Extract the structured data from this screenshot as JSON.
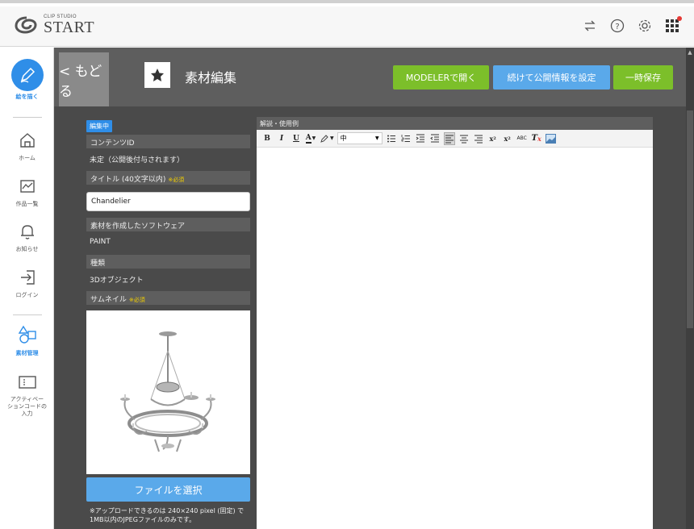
{
  "app": {
    "logo_small": "CLIP STUDIO",
    "logo_big": "START"
  },
  "sidebar": {
    "items": [
      {
        "label": "絵を描く",
        "icon": "pen-icon"
      },
      {
        "label": "ホーム",
        "icon": "home-icon"
      },
      {
        "label": "作品一覧",
        "icon": "gallery-icon"
      },
      {
        "label": "お知らせ",
        "icon": "bell-icon"
      },
      {
        "label": "ログイン",
        "icon": "login-icon"
      },
      {
        "label": "素材管理",
        "icon": "materials-icon"
      },
      {
        "label": "アクティベーションコードの入力",
        "label_lines": [
          "アクティベー",
          "ションコードの",
          "入力"
        ],
        "icon": "ticket-icon"
      }
    ]
  },
  "header": {
    "back_label": "< もどる",
    "title": "素材編集",
    "modeler_button": "MODELERで開く",
    "publish_button": "続けて公開情報を設定",
    "save_button": "一時保存"
  },
  "form": {
    "editing_badge": "編集中",
    "content_id_label": "コンテンツID",
    "content_id_value": "未定（公開後付与されます）",
    "title_label": "タイトル (40文字以内)",
    "required_mark": "※必須",
    "title_value": "Chandelier",
    "software_label": "素材を作成したソフトウェア",
    "software_value": "PAINT",
    "type_label": "種類",
    "type_value": "3Dオブジェクト",
    "thumbnail_label": "サムネイル",
    "file_button": "ファイルを選択",
    "upload_note": "※アップロードできるのは 240×240 pixel (固定) で1MB以内のJPEGファイルのみです。"
  },
  "editor": {
    "heading": "解説・使用例",
    "font_size_value": "中",
    "toolbar": [
      "B",
      "I",
      "U",
      "A",
      "pen",
      "size",
      "bullet-list",
      "number-list",
      "indent",
      "outdent",
      "align-left",
      "align-center",
      "align-right",
      "subscript",
      "superscript",
      "spellcheck",
      "clear-format",
      "image"
    ]
  },
  "colors": {
    "accent_blue": "#2f8ee8",
    "green": "#7cbf2a",
    "light_blue": "#5aa9ea",
    "dark_bg": "#4a4a4a"
  }
}
